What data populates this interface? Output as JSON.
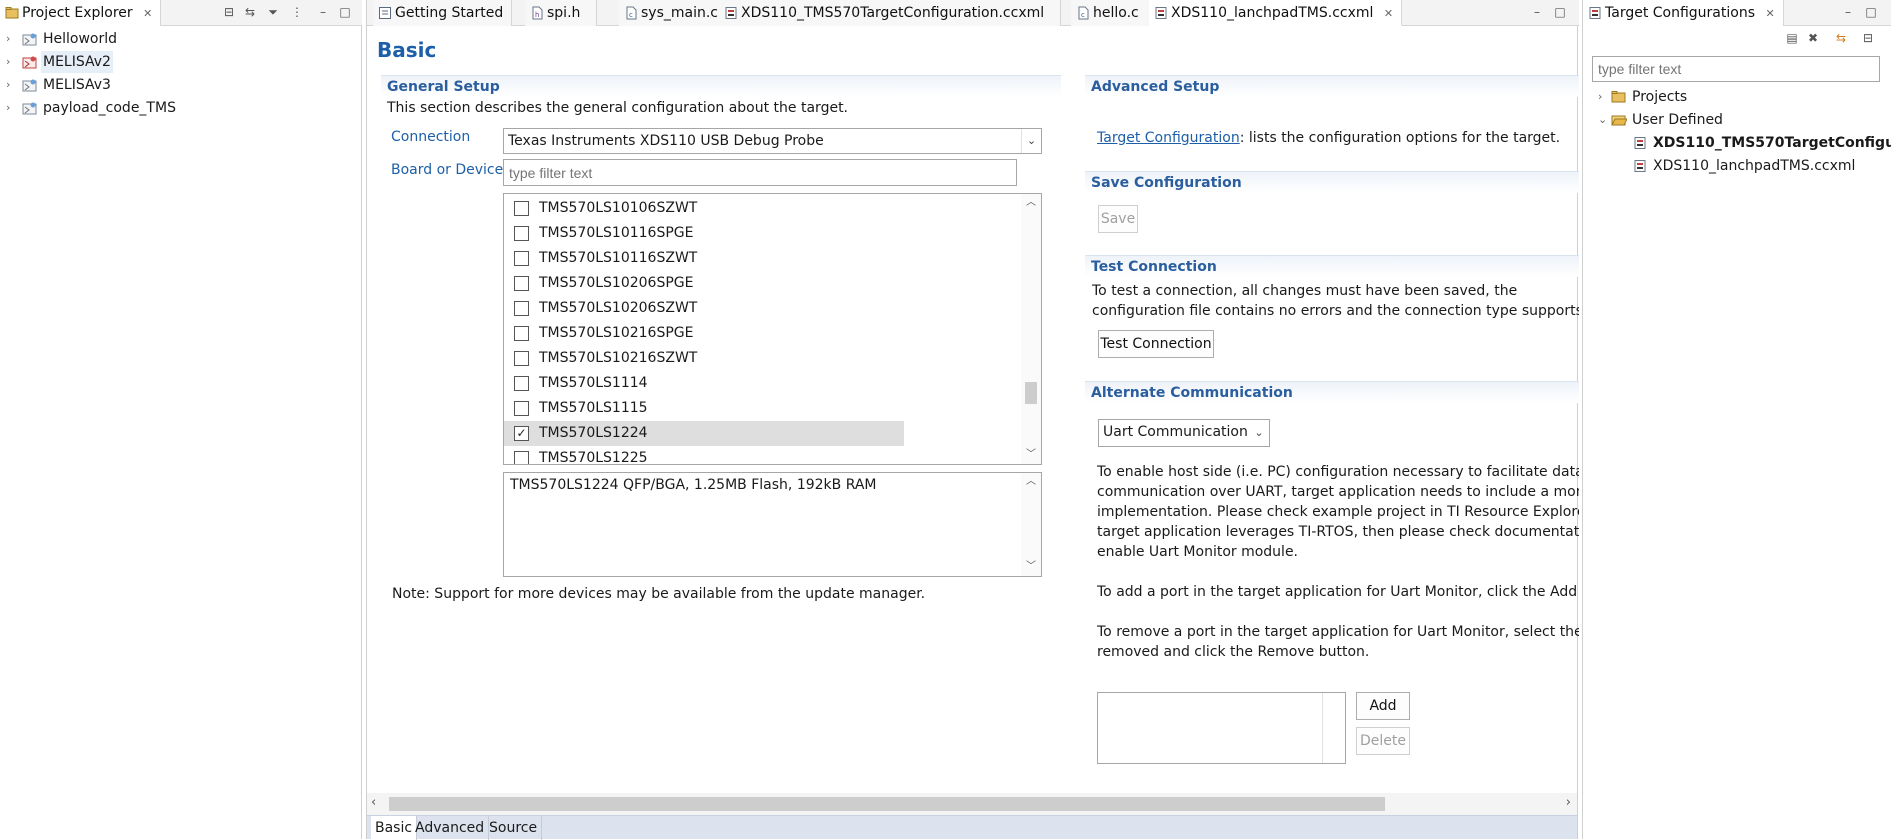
{
  "colors": {
    "accent": "#1d5fa8",
    "section_header": "#2a5e9e",
    "selection": "#dedede"
  },
  "project_explorer": {
    "title": "Project Explorer",
    "projects": [
      {
        "name": "Helloworld",
        "icon": "project-folder-icon"
      },
      {
        "name": "MELISAv2",
        "icon": "project-folder-active-icon"
      },
      {
        "name": "MELISAv3",
        "icon": "project-folder-icon"
      },
      {
        "name": "payload_code_TMS",
        "icon": "project-folder-icon"
      }
    ]
  },
  "editor": {
    "tabs": [
      {
        "label": "Getting Started",
        "icon": "getting-started-icon"
      },
      {
        "label": "spi.h",
        "icon": "header-file-icon"
      },
      {
        "label": "sys_main.c",
        "icon": "c-file-icon"
      },
      {
        "label": "XDS110_TMS570TargetConfiguration.ccxml",
        "icon": "ccxml-file-icon"
      },
      {
        "label": "hello.c",
        "icon": "c-file-icon"
      },
      {
        "label": "XDS110_lanchpadTMS.ccxml",
        "icon": "ccxml-file-icon",
        "active": true
      }
    ],
    "page_title": "Basic",
    "general_setup": {
      "title": "General Setup",
      "description": "This section describes the general configuration about the target.",
      "connection_label": "Connection",
      "connection_value": "Texas Instruments XDS110 USB Debug Probe",
      "board_label": "Board or Device",
      "filter_placeholder": "type filter text",
      "devices": [
        {
          "name": "TMS570LS10106SZWT",
          "checked": false
        },
        {
          "name": "TMS570LS10116SPGE",
          "checked": false
        },
        {
          "name": "TMS570LS10116SZWT",
          "checked": false
        },
        {
          "name": "TMS570LS10206SPGE",
          "checked": false
        },
        {
          "name": "TMS570LS10206SZWT",
          "checked": false
        },
        {
          "name": "TMS570LS10216SPGE",
          "checked": false
        },
        {
          "name": "TMS570LS10216SZWT",
          "checked": false
        },
        {
          "name": "TMS570LS1114",
          "checked": false
        },
        {
          "name": "TMS570LS1115",
          "checked": false
        },
        {
          "name": "TMS570LS1224",
          "checked": true
        },
        {
          "name": "TMS570LS1225",
          "checked": false
        }
      ],
      "device_description": "TMS570LS1224 QFP/BGA, 1.25MB Flash, 192kB RAM",
      "note": "Note: Support for more devices may be available from the update manager."
    },
    "advanced_setup": {
      "title": "Advanced Setup",
      "link": "Target Configuration",
      "link_suffix": ": lists the configuration options for the target."
    },
    "save_configuration": {
      "title": "Save Configuration",
      "button": "Save"
    },
    "test_connection": {
      "title": "Test Connection",
      "line1": "To test a connection, all changes must have been saved, the",
      "line2": "configuration file contains no errors and the connection type supports this",
      "button": "Test Connection"
    },
    "alternate_communication": {
      "title": "Alternate Communication",
      "dropdown_value": "Uart Communication",
      "para1": [
        "To enable host side (i.e. PC) configuration necessary to facilitate data",
        "communication over UART, target application needs to include a monitor",
        "implementation. Please check example project in TI Resource Explorer. If",
        "target application leverages TI-RTOS, then please check documentation o",
        "enable Uart Monitor module."
      ],
      "para2": "To add a port in the target application for Uart Monitor, click the Add bu",
      "para3": [
        "To remove a port in the target application for Uart Monitor, select the po",
        "removed and click the Remove button."
      ],
      "add_button": "Add",
      "delete_button": "Delete"
    },
    "bottom_tabs": [
      "Basic",
      "Advanced",
      "Source"
    ]
  },
  "target_configurations": {
    "title": "Target Configurations",
    "filter_placeholder": "type filter text",
    "tree": {
      "projects_label": "Projects",
      "user_defined_label": "User Defined",
      "files": [
        {
          "name": "XDS110_TMS570TargetConfigu",
          "bold": true
        },
        {
          "name": "XDS110_lanchpadTMS.ccxml",
          "bold": false
        }
      ]
    }
  }
}
